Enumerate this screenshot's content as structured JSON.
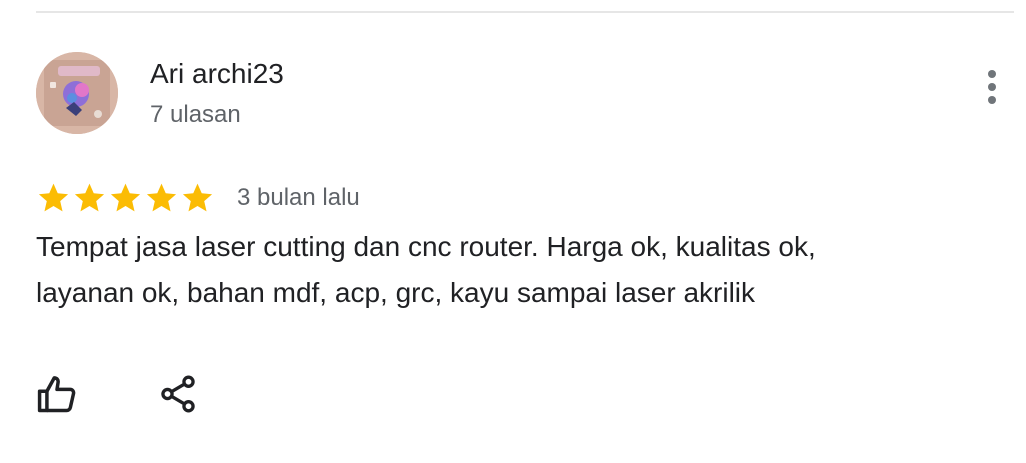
{
  "reviewer": {
    "name": "Ari archi23",
    "review_count": "7 ulasan"
  },
  "review": {
    "rating": 5,
    "rating_max": 5,
    "date": "3 bulan lalu",
    "text": "Tempat jasa laser cutting dan cnc router. Harga ok, kualitas ok,\nlayanan ok, bahan mdf, acp, grc, kayu sampai laser akrilik"
  },
  "colors": {
    "star": "#fbbc04",
    "name": "#202124",
    "secondary_text": "#5f6368",
    "icon": "#202124"
  },
  "icons": {
    "more": "more-vert-icon",
    "like": "thumb-up-icon",
    "share": "share-icon"
  }
}
